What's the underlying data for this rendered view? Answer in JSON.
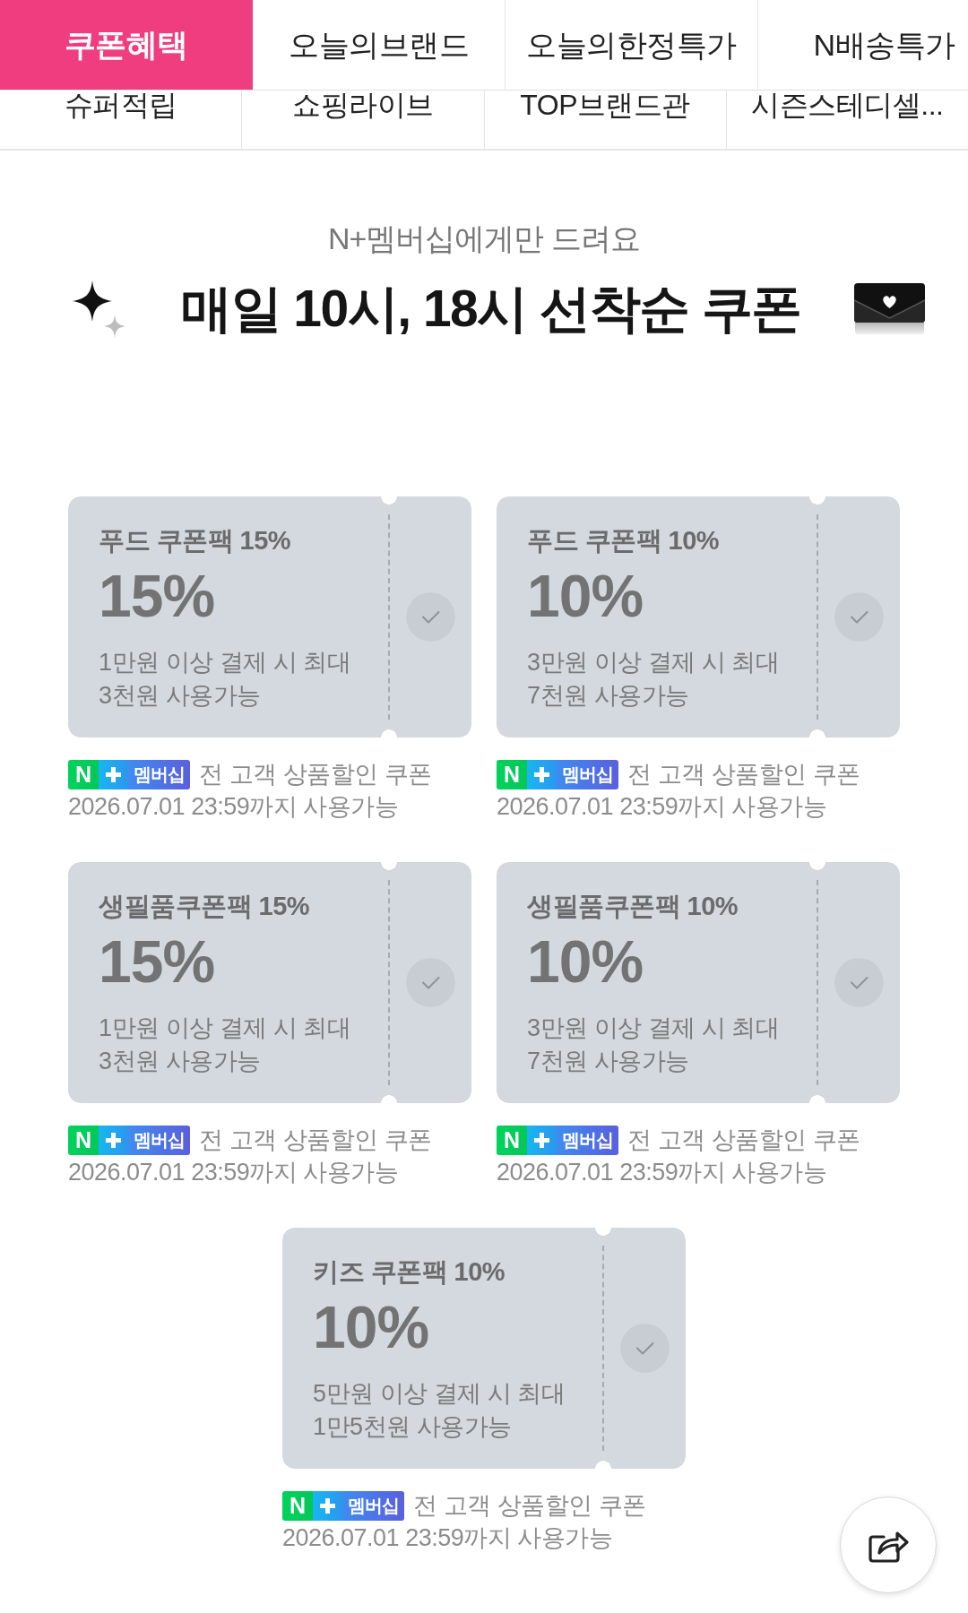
{
  "tabs_primary": [
    {
      "label": "쿠폰혜택",
      "selected": true
    },
    {
      "label": "오늘의브랜드",
      "selected": false
    },
    {
      "label": "오늘의한정특가",
      "selected": false
    },
    {
      "label": "N배송특가",
      "selected": false
    }
  ],
  "tabs_secondary": [
    {
      "label": "슈퍼적립",
      "selected": false
    },
    {
      "label": "쇼핑라이브",
      "selected": false
    },
    {
      "label": "TOP브랜드관",
      "selected": false
    },
    {
      "label": "시즌스테디셀...",
      "selected": false
    }
  ],
  "header": {
    "subtitle": "N+멤버십에게만 드려요",
    "title": "매일 10시, 18시 선착순 쿠폰"
  },
  "coupons": [
    {
      "name": "푸드 쿠폰팩 15%",
      "discount": "15%",
      "condition": "1만원 이상 결제 시 최대\n3천원 사용가능",
      "claimed": false,
      "badge_logo": "N",
      "badge_label": "멤버십",
      "audience": "전 고객 상품할인 쿠폰",
      "validity": "2026.07.01 23:59까지 사용가능"
    },
    {
      "name": "푸드 쿠폰팩 10%",
      "discount": "10%",
      "condition": "3만원 이상 결제 시 최대\n7천원 사용가능",
      "claimed": false,
      "badge_logo": "N",
      "badge_label": "멤버십",
      "audience": "전 고객 상품할인 쿠폰",
      "validity": "2026.07.01 23:59까지 사용가능"
    },
    {
      "name": "생필품쿠폰팩 15%",
      "discount": "15%",
      "condition": "1만원 이상 결제 시 최대\n3천원 사용가능",
      "claimed": false,
      "badge_logo": "N",
      "badge_label": "멤버십",
      "audience": "전 고객 상품할인 쿠폰",
      "validity": "2026.07.01 23:59까지 사용가능"
    },
    {
      "name": "생필품쿠폰팩 10%",
      "discount": "10%",
      "condition": "3만원 이상 결제 시 최대\n7천원 사용가능",
      "claimed": false,
      "badge_logo": "N",
      "badge_label": "멤버십",
      "audience": "전 고객 상품할인 쿠폰",
      "validity": "2026.07.01 23:59까지 사용가능"
    },
    {
      "name": "키즈 쿠폰팩 10%",
      "discount": "10%",
      "condition": "5만원 이상 결제 시 최대\n1만5천원 사용가능",
      "claimed": false,
      "badge_logo": "N",
      "badge_label": "멤버십",
      "audience": "전 고객 상품할인 쿠폰",
      "validity": "2026.07.01 23:59까지 사용가능"
    }
  ]
}
